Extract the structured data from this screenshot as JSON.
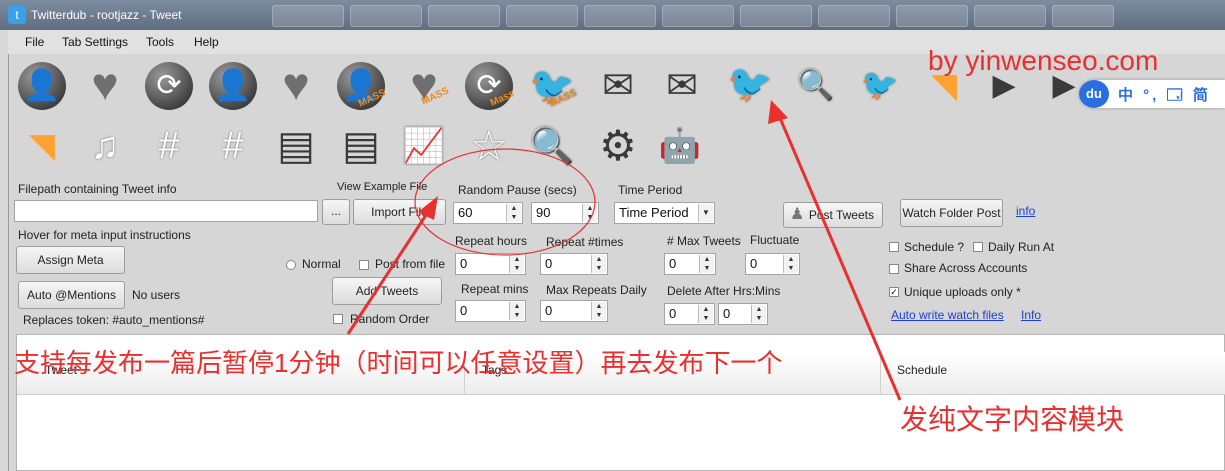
{
  "window": {
    "title": "Twitterdub - rootjazz  - Tweet"
  },
  "menu": [
    "File",
    "Tab Settings",
    "Tools",
    "Help"
  ],
  "toolbar_row1": [
    {
      "icon": "add-user-icon"
    },
    {
      "icon": "heart-icon"
    },
    {
      "icon": "retweet-icon"
    },
    {
      "icon": "remove-user-icon"
    },
    {
      "icon": "unlike-icon"
    },
    {
      "icon": "mass-follow-icon",
      "tag": "MASS"
    },
    {
      "icon": "mass-like-icon",
      "tag": "MASS"
    },
    {
      "icon": "mass-retweet-icon",
      "tag": "Mass"
    },
    {
      "icon": "mass-tweet-icon",
      "tag": "MASS"
    },
    {
      "icon": "message-icon"
    },
    {
      "icon": "download-message-icon"
    },
    {
      "icon": "twitter-bird-icon"
    },
    {
      "icon": "search-bird-icon"
    },
    {
      "icon": "bird-group-icon"
    },
    {
      "icon": "rss-icon"
    },
    {
      "icon": "youtube-icon"
    },
    {
      "icon": "youtube-rss-icon"
    }
  ],
  "toolbar_row2": [
    {
      "icon": "rss-feed-icon"
    },
    {
      "icon": "music-icon"
    },
    {
      "icon": "hashtag-user-icon"
    },
    {
      "icon": "hashtag-group-icon"
    },
    {
      "icon": "spreadsheet-icon"
    },
    {
      "icon": "upload-sheet-icon"
    },
    {
      "icon": "stats-icon"
    },
    {
      "icon": "star-icon"
    },
    {
      "icon": "search-icon"
    },
    {
      "icon": "settings-gears-icon"
    },
    {
      "icon": "robot-icon"
    }
  ],
  "form": {
    "filepath_label": "Filepath containing Tweet info",
    "filepath_value": "",
    "browse_label": "...",
    "view_example_label": "View Example File",
    "import_label": "Import File",
    "pause_label": "Random Pause (secs)",
    "pause_min": "60",
    "pause_max": "90",
    "time_period_label": "Time Period",
    "time_period_value": "Time Period",
    "post_tweets_label": "Post Tweets",
    "watch_folder_label": "Watch Folder Post",
    "info_link": "info",
    "hover_label": "Hover for meta input instructions",
    "assign_meta_label": "Assign Meta",
    "auto_mentions_label": "Auto @Mentions",
    "no_users_label": "No users",
    "replaces_token_label": "Replaces token: #auto_mentions#",
    "normal_label": "Normal",
    "post_from_file_label": "Post from file",
    "add_tweets_label": "Add Tweets",
    "random_order_label": "Random Order",
    "repeat_hours_label": "Repeat hours",
    "repeat_hours_value": "0",
    "repeat_times_label": "Repeat #times",
    "repeat_times_value": "0",
    "max_tweets_label": "# Max Tweets",
    "max_tweets_value": "0",
    "fluctuate_label": "Fluctuate",
    "fluctuate_value": "0",
    "repeat_mins_label": "Repeat mins",
    "repeat_mins_value": "0",
    "max_repeats_daily_label": "Max Repeats Daily",
    "max_repeats_daily_value": "0",
    "delete_after_label": "Delete After Hrs:Mins",
    "delete_hrs_value": "0",
    "delete_mins_value": "0",
    "schedule_label": "Schedule ?",
    "daily_run_label": "Daily Run At",
    "share_across_label": "Share Across Accounts",
    "unique_uploads_label": "Unique uploads only *",
    "unique_uploads_checked": "✓",
    "auto_write_link": "Auto write watch files",
    "info_link2": "Info"
  },
  "table": {
    "columns": [
      "Tweet",
      "Tags",
      "Schedule"
    ]
  },
  "annotations": {
    "watermark": "by yinwenseo.com",
    "caption_main": "支持每发布一篇后暂停1分钟（时间可以任意设置）再去发布下一个",
    "caption_side": "发纯文字内容模块",
    "ime_logo": "du",
    "ime_text": "中 °, 🗔 简"
  },
  "colors": {
    "annotation": "#e8302f",
    "link": "#1c3fcf",
    "mass_tag": "#f08a1c"
  }
}
